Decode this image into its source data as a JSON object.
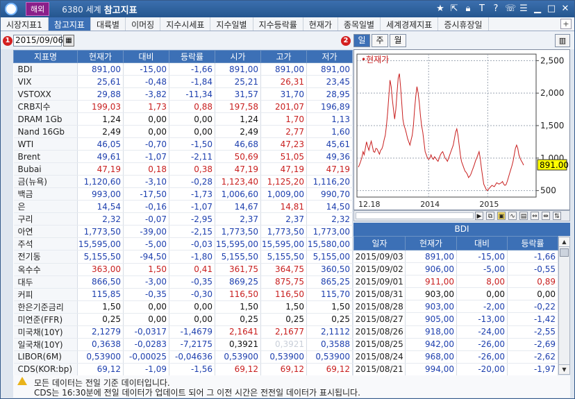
{
  "titlebar": {
    "badge": "해외",
    "code": "6380 세계",
    "title": "참고지표",
    "icons": [
      "star-icon",
      "export-icon",
      "lock-icon",
      "text-icon",
      "help-icon",
      "phone-icon",
      "list-icon",
      "minimize-icon",
      "maximize-icon",
      "close-icon"
    ]
  },
  "tabs": [
    {
      "label": "시장지표1",
      "active": false
    },
    {
      "label": "참고지표",
      "active": true
    },
    {
      "label": "대륙별",
      "active": false
    },
    {
      "label": "이머징",
      "active": false
    },
    {
      "label": "지수시세표",
      "active": false
    },
    {
      "label": "지수일별",
      "active": false
    },
    {
      "label": "지수등락률",
      "active": false
    },
    {
      "label": "현재가",
      "active": false
    },
    {
      "label": "종목일별",
      "active": false
    },
    {
      "label": "세계경제지표",
      "active": false
    },
    {
      "label": "증시휴장일",
      "active": false
    }
  ],
  "tab_add": "+",
  "toolbar": {
    "marker1": "1",
    "marker2": "2",
    "date": "2015/09/06",
    "periods": [
      "일",
      "주",
      "월"
    ],
    "active_period": "일"
  },
  "main_table": {
    "headers": [
      "지표명",
      "현재가",
      "대비",
      "등락률",
      "시가",
      "고가",
      "저가"
    ],
    "rows": [
      {
        "name": "BDI",
        "cur": "891,00",
        "chg": "-15,00",
        "rate": "-1,66",
        "open": "891,00",
        "high": "891,00",
        "low": "891,00",
        "dir": "down",
        "open_dir": "down",
        "high_dir": "down",
        "low_dir": "down"
      },
      {
        "name": "VIX",
        "cur": "25,61",
        "chg": "-0,48",
        "rate": "-1,84",
        "open": "25,21",
        "high": "26,31",
        "low": "23,45",
        "dir": "down",
        "open_dir": "down",
        "high_dir": "up",
        "low_dir": "down"
      },
      {
        "name": "VSTOXX",
        "cur": "29,88",
        "chg": "-3,82",
        "rate": "-11,34",
        "open": "31,57",
        "high": "31,70",
        "low": "28,95",
        "dir": "down",
        "open_dir": "down",
        "high_dir": "down",
        "low_dir": "down"
      },
      {
        "name": "CRB지수",
        "cur": "199,03",
        "chg": "1,73",
        "rate": "0,88",
        "open": "197,58",
        "high": "201,07",
        "low": "196,89",
        "dir": "up",
        "open_dir": "up",
        "high_dir": "up",
        "low_dir": "down"
      },
      {
        "name": "DRAM 1Gb",
        "cur": "1,24",
        "chg": "0,00",
        "rate": "0,00",
        "open": "1,24",
        "high": "1,70",
        "low": "1,13",
        "dir": "flat",
        "open_dir": "flat",
        "high_dir": "up",
        "low_dir": "down"
      },
      {
        "name": "Nand 16Gb",
        "cur": "2,49",
        "chg": "0,00",
        "rate": "0,00",
        "open": "2,49",
        "high": "2,77",
        "low": "1,60",
        "dir": "flat",
        "open_dir": "flat",
        "high_dir": "up",
        "low_dir": "down"
      },
      {
        "name": "WTI",
        "cur": "46,05",
        "chg": "-0,70",
        "rate": "-1,50",
        "open": "46,68",
        "high": "47,23",
        "low": "45,61",
        "dir": "down",
        "open_dir": "down",
        "high_dir": "up",
        "low_dir": "down"
      },
      {
        "name": "Brent",
        "cur": "49,61",
        "chg": "-1,07",
        "rate": "-2,11",
        "open": "50,69",
        "high": "51,05",
        "low": "49,36",
        "dir": "down",
        "open_dir": "up",
        "high_dir": "up",
        "low_dir": "down"
      },
      {
        "name": "Bubai",
        "cur": "47,19",
        "chg": "0,18",
        "rate": "0,38",
        "open": "47,19",
        "high": "47,19",
        "low": "47,19",
        "dir": "up",
        "open_dir": "up",
        "high_dir": "up",
        "low_dir": "up"
      },
      {
        "name": "금(뉴욕)",
        "cur": "1,120,60",
        "chg": "-3,10",
        "rate": "-0,28",
        "open": "1,123,40",
        "high": "1,125,20",
        "low": "1,116,20",
        "dir": "down",
        "open_dir": "up",
        "high_dir": "up",
        "low_dir": "down"
      },
      {
        "name": "백금",
        "cur": "993,00",
        "chg": "-17,50",
        "rate": "-1,73",
        "open": "1,006,60",
        "high": "1,009,00",
        "low": "990,70",
        "dir": "down",
        "open_dir": "down",
        "high_dir": "down",
        "low_dir": "down"
      },
      {
        "name": "은",
        "cur": "14,54",
        "chg": "-0,16",
        "rate": "-1,07",
        "open": "14,67",
        "high": "14,81",
        "low": "14,50",
        "dir": "down",
        "open_dir": "down",
        "high_dir": "up",
        "low_dir": "down"
      },
      {
        "name": "구리",
        "cur": "2,32",
        "chg": "-0,07",
        "rate": "-2,95",
        "open": "2,37",
        "high": "2,37",
        "low": "2,32",
        "dir": "down",
        "open_dir": "down",
        "high_dir": "down",
        "low_dir": "down"
      },
      {
        "name": "아연",
        "cur": "1,773,50",
        "chg": "-39,00",
        "rate": "-2,15",
        "open": "1,773,50",
        "high": "1,773,50",
        "low": "1,773,00",
        "dir": "down",
        "open_dir": "down",
        "high_dir": "down",
        "low_dir": "down"
      },
      {
        "name": "주석",
        "cur": "15,595,00",
        "chg": "-5,00",
        "rate": "-0,03",
        "open": "15,595,00",
        "high": "15,595,00",
        "low": "15,580,00",
        "dir": "down",
        "open_dir": "down",
        "high_dir": "down",
        "low_dir": "down"
      },
      {
        "name": "전기동",
        "cur": "5,155,50",
        "chg": "-94,50",
        "rate": "-1,80",
        "open": "5,155,50",
        "high": "5,155,50",
        "low": "5,155,00",
        "dir": "down",
        "open_dir": "down",
        "high_dir": "down",
        "low_dir": "down"
      },
      {
        "name": "옥수수",
        "cur": "363,00",
        "chg": "1,50",
        "rate": "0,41",
        "open": "361,75",
        "high": "364,75",
        "low": "360,50",
        "dir": "up",
        "open_dir": "up",
        "high_dir": "up",
        "low_dir": "down"
      },
      {
        "name": "대두",
        "cur": "866,50",
        "chg": "-3,00",
        "rate": "-0,35",
        "open": "869,25",
        "high": "875,75",
        "low": "865,25",
        "dir": "down",
        "open_dir": "down",
        "high_dir": "up",
        "low_dir": "down"
      },
      {
        "name": "커피",
        "cur": "115,85",
        "chg": "-0,35",
        "rate": "-0,30",
        "open": "116,50",
        "high": "116,50",
        "low": "115,70",
        "dir": "down",
        "open_dir": "up",
        "high_dir": "up",
        "low_dir": "down"
      },
      {
        "name": "한은기준금리",
        "cur": "1,50",
        "chg": "0,00",
        "rate": "0,00",
        "open": "1,50",
        "high": "1,50",
        "low": "1,50",
        "dir": "flat",
        "open_dir": "flat",
        "high_dir": "flat",
        "low_dir": "flat"
      },
      {
        "name": "미연준(FFR)",
        "cur": "0,25",
        "chg": "0,00",
        "rate": "0,00",
        "open": "0,25",
        "high": "0,25",
        "low": "0,25",
        "dir": "flat",
        "open_dir": "flat",
        "high_dir": "flat",
        "low_dir": "flat"
      },
      {
        "name": "미국채(10Y)",
        "cur": "2,1279",
        "chg": "-0,0317",
        "rate": "-1,4679",
        "open": "2,1641",
        "high": "2,1677",
        "low": "2,1112",
        "dir": "down",
        "open_dir": "up",
        "high_dir": "up",
        "low_dir": "down"
      },
      {
        "name": "일국채(10Y)",
        "cur": "0,3638",
        "chg": "-0,0283",
        "rate": "-7,2175",
        "open": "0,3921",
        "high": "0,3921",
        "low": "0,3588",
        "dir": "down",
        "open_dir": "flat",
        "high_dir": "dim",
        "low_dir": "down"
      },
      {
        "name": "LIBOR(6M)",
        "cur": "0,53900",
        "chg": "-0,00025",
        "rate": "-0,04636",
        "open": "0,53900",
        "high": "0,53900",
        "low": "0,53900",
        "dir": "down",
        "open_dir": "down",
        "high_dir": "down",
        "low_dir": "down"
      },
      {
        "name": "CDS(KOR:bp)",
        "cur": "69,12",
        "chg": "-1,09",
        "rate": "-1,56",
        "open": "69,12",
        "high": "69,12",
        "low": "69,12",
        "dir": "down",
        "open_dir": "up",
        "high_dir": "up",
        "low_dir": "up"
      }
    ]
  },
  "chart_data": {
    "type": "line",
    "title": "",
    "legend": "현재가",
    "x_tick_labels": [
      "12.18",
      "2014",
      "2015"
    ],
    "y_tick_labels": [
      "2,500",
      "2,000",
      "1,500",
      "1,000",
      "500"
    ],
    "ylim": [
      400,
      2600
    ],
    "current_label": "891.00",
    "current_value": 891,
    "grid": true,
    "series_color": "#c81e1e",
    "values": [
      860,
      900,
      950,
      1010,
      1100,
      1050,
      1150,
      1250,
      1180,
      1120,
      1200,
      1260,
      1180,
      1100,
      1090,
      1150,
      1140,
      1100,
      1060,
      1120,
      1140,
      1190,
      1280,
      1350,
      1500,
      1700,
      1950,
      2200,
      2100,
      1900,
      1750,
      1600,
      1750,
      2000,
      2230,
      2300,
      2100,
      1850,
      1600,
      1500,
      1450,
      1380,
      1300,
      1250,
      1200,
      1280,
      1350,
      1500,
      1750,
      1950,
      2100,
      2000,
      1850,
      1650,
      1500,
      1400,
      1250,
      1100,
      1050,
      1000,
      980,
      1000,
      1050,
      1000,
      980,
      1020,
      1000,
      970,
      950,
      1000,
      1050,
      1080,
      1100,
      1050,
      1000,
      980,
      950,
      1000,
      1050,
      1100,
      1150,
      1200,
      1300,
      1400,
      1450,
      1350,
      1200,
      1050,
      950,
      900,
      850,
      800,
      780,
      750,
      700,
      720,
      750,
      800,
      850,
      900,
      960,
      1000,
      1050,
      1100,
      1000,
      850,
      720,
      600,
      560,
      520,
      500,
      520,
      540,
      560,
      580,
      570,
      560,
      590,
      620,
      610,
      600,
      610,
      620,
      640,
      600,
      580,
      590,
      640,
      700,
      760,
      820,
      880,
      950,
      1050,
      1150,
      1200,
      1150,
      1050,
      1000,
      960,
      930,
      891
    ]
  },
  "chart_toolbar": [
    "arrow-right-icon",
    "copy-icon",
    "tooltip-icon",
    "tilde-icon",
    "bar-icon",
    "fit-icon",
    "zoom-in-icon",
    "zoom-out-icon"
  ],
  "side_table": {
    "title": "BDI",
    "headers": [
      "일자",
      "현재가",
      "대비",
      "등락률"
    ],
    "rows": [
      {
        "date": "2015/09/03",
        "cur": "891,00",
        "chg": "-15,00",
        "rate": "-1,66",
        "dir": "down"
      },
      {
        "date": "2015/09/02",
        "cur": "906,00",
        "chg": "-5,00",
        "rate": "-0,55",
        "dir": "down"
      },
      {
        "date": "2015/09/01",
        "cur": "911,00",
        "chg": "8,00",
        "rate": "0,89",
        "dir": "up"
      },
      {
        "date": "2015/08/31",
        "cur": "903,00",
        "chg": "0,00",
        "rate": "0,00",
        "dir": "flat"
      },
      {
        "date": "2015/08/28",
        "cur": "903,00",
        "chg": "-2,00",
        "rate": "-0,22",
        "dir": "down"
      },
      {
        "date": "2015/08/27",
        "cur": "905,00",
        "chg": "-13,00",
        "rate": "-1,42",
        "dir": "down"
      },
      {
        "date": "2015/08/26",
        "cur": "918,00",
        "chg": "-24,00",
        "rate": "-2,55",
        "dir": "down"
      },
      {
        "date": "2015/08/25",
        "cur": "942,00",
        "chg": "-26,00",
        "rate": "-2,69",
        "dir": "down"
      },
      {
        "date": "2015/08/24",
        "cur": "968,00",
        "chg": "-26,00",
        "rate": "-2,62",
        "dir": "down"
      },
      {
        "date": "2015/08/21",
        "cur": "994,00",
        "chg": "-20,00",
        "rate": "-1,97",
        "dir": "down"
      }
    ]
  },
  "footer": {
    "line1": "모든 데이터는 전일 기준 데이터입니다.",
    "line2": "CDS는 16:30분에 전일 데이터가 업데이트 되어 그 이전 시간은 전전일 데이터가 표시됩니다."
  }
}
